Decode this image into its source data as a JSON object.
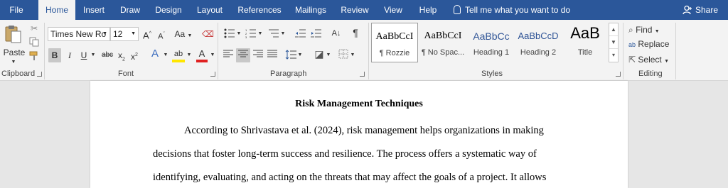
{
  "menubar": {
    "tabs": [
      {
        "label": "File"
      },
      {
        "label": "Home"
      },
      {
        "label": "Insert"
      },
      {
        "label": "Draw"
      },
      {
        "label": "Design"
      },
      {
        "label": "Layout"
      },
      {
        "label": "References"
      },
      {
        "label": "Mailings"
      },
      {
        "label": "Review"
      },
      {
        "label": "View"
      },
      {
        "label": "Help"
      }
    ],
    "active_tab": "Home",
    "tell_me": "Tell me what you want to do",
    "share": "Share",
    "bar_color": "#2b579a"
  },
  "ribbon": {
    "clipboard": {
      "label": "Clipboard",
      "paste": "Paste"
    },
    "font": {
      "label": "Font",
      "font_name": "Times New Ro",
      "font_size": "12",
      "grow": "A",
      "shrink": "A",
      "change_case": "Aa",
      "bold": "B",
      "italic": "I",
      "underline": "U",
      "strike": "abc",
      "subscript": "x",
      "superscript": "x",
      "text_effects": "A",
      "highlight": "ab",
      "font_color": "A"
    },
    "paragraph": {
      "label": "Paragraph"
    },
    "styles": {
      "label": "Styles",
      "items": [
        {
          "preview": "AaBbCcI",
          "name": "¶ Rozzie"
        },
        {
          "preview": "AaBbCcI",
          "name": "¶ No Spac..."
        },
        {
          "preview": "AaBbCc",
          "name": "Heading 1"
        },
        {
          "preview": "AaBbCcD",
          "name": "Heading 2"
        },
        {
          "preview": "AaB",
          "name": "Title"
        }
      ]
    },
    "editing": {
      "label": "Editing",
      "find": "Find",
      "replace": "Replace",
      "select": "Select"
    }
  },
  "document": {
    "title": "Risk Management Techniques",
    "lines": [
      "According to Shrivastava et al. (2024), risk management helps organizations in making",
      "decisions that foster long-term success and resilience. The process offers a systematic way of",
      "identifying, evaluating, and acting on the threats that may affect the goals of a project. It allows"
    ]
  }
}
